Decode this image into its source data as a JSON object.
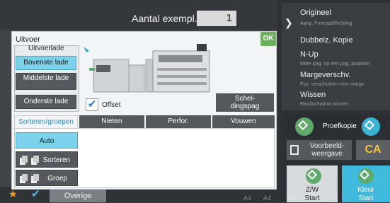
{
  "header": {
    "copies_label": "Aantal exempl.",
    "copies_value": "1"
  },
  "dialog": {
    "title": "Uitvoer",
    "ok_label": "OK",
    "output_tray": {
      "label": "Uitvoerlade",
      "options": [
        "Bovenste lade",
        "Middelste lade",
        "Onderste lade"
      ],
      "selected": "Bovenste lade"
    },
    "offset": {
      "label": "Offset",
      "checked": true
    },
    "separator_button": "Schei-\ndingspag",
    "tabs": [
      "Sorteren/groepen",
      "Nieten",
      "Perfor.",
      "Vouwen"
    ],
    "active_tab": "Sorteren/groepen",
    "sort_options": [
      "Auto",
      "Sorteren",
      "Groep"
    ],
    "sort_selected": "Auto"
  },
  "right_panel": {
    "items": [
      {
        "title": "Origineel",
        "subtitle": "Aanp. Formaat/Richting."
      },
      {
        "title": "Dubbelz. Kopie",
        "subtitle": ""
      },
      {
        "title": "N-Up",
        "subtitle": "Meer pag. op een pag. plaatsen"
      },
      {
        "title": "Margeverschv.",
        "subtitle": "Pos. verschuiven voor marge"
      },
      {
        "title": "Wissen",
        "subtitle": "Randschaduw wissen"
      }
    ],
    "proof_label": "Proefkopie",
    "preview_label": "Voorbeeld-\nweergave",
    "ca_label": "CA",
    "bw_start": "Z/W\nStart",
    "color_start": "Kleur\nStart"
  },
  "bottom_bar": {
    "other_label": "Overige",
    "paper_labels": [
      "A4",
      "A4"
    ]
  },
  "colors": {
    "accent": "#7cd2ea",
    "ok": "#6cb25c",
    "color_start": "#3fb9dc",
    "star": "#f0a02a"
  },
  "icons": [
    "star-icon",
    "check-icon",
    "chevron-right-icon",
    "diamond-icon",
    "preview-icon",
    "checkmark-icon",
    "stack-icon"
  ]
}
